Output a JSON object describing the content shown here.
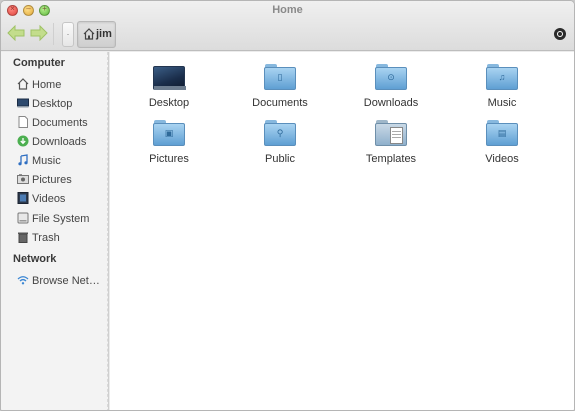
{
  "window": {
    "title": "Home",
    "controls": {
      "close": "×",
      "minimize": "–",
      "maximize": "+"
    }
  },
  "toolbar": {
    "back_icon": "arrow-left-icon",
    "forward_icon": "arrow-right-icon",
    "breadcrumb_root": "·",
    "breadcrumb_current": "jim",
    "search_icon": "search-icon"
  },
  "sidebar": {
    "computer_heading": "Computer",
    "items": [
      {
        "label": "Home",
        "icon": "home-icon"
      },
      {
        "label": "Desktop",
        "icon": "desktop-icon"
      },
      {
        "label": "Documents",
        "icon": "documents-icon"
      },
      {
        "label": "Downloads",
        "icon": "downloads-icon"
      },
      {
        "label": "Music",
        "icon": "music-icon"
      },
      {
        "label": "Pictures",
        "icon": "pictures-icon"
      },
      {
        "label": "Videos",
        "icon": "videos-icon"
      },
      {
        "label": "File System",
        "icon": "filesystem-icon"
      },
      {
        "label": "Trash",
        "icon": "trash-icon"
      }
    ],
    "network_heading": "Network",
    "network_items": [
      {
        "label": "Browse Net…",
        "icon": "wifi-icon"
      }
    ]
  },
  "files": [
    {
      "label": "Desktop",
      "icon": "desktop-folder-icon"
    },
    {
      "label": "Documents",
      "icon": "documents-folder-icon"
    },
    {
      "label": "Downloads",
      "icon": "downloads-folder-icon"
    },
    {
      "label": "Music",
      "icon": "music-folder-icon"
    },
    {
      "label": "Pictures",
      "icon": "pictures-folder-icon"
    },
    {
      "label": "Public",
      "icon": "public-folder-icon"
    },
    {
      "label": "Templates",
      "icon": "templates-folder-icon"
    },
    {
      "label": "Videos",
      "icon": "videos-folder-icon"
    }
  ],
  "colors": {
    "nav_arrow": "#b2d37a",
    "folder_light": "#a9d3f1",
    "folder_dark": "#5f9fd3"
  }
}
